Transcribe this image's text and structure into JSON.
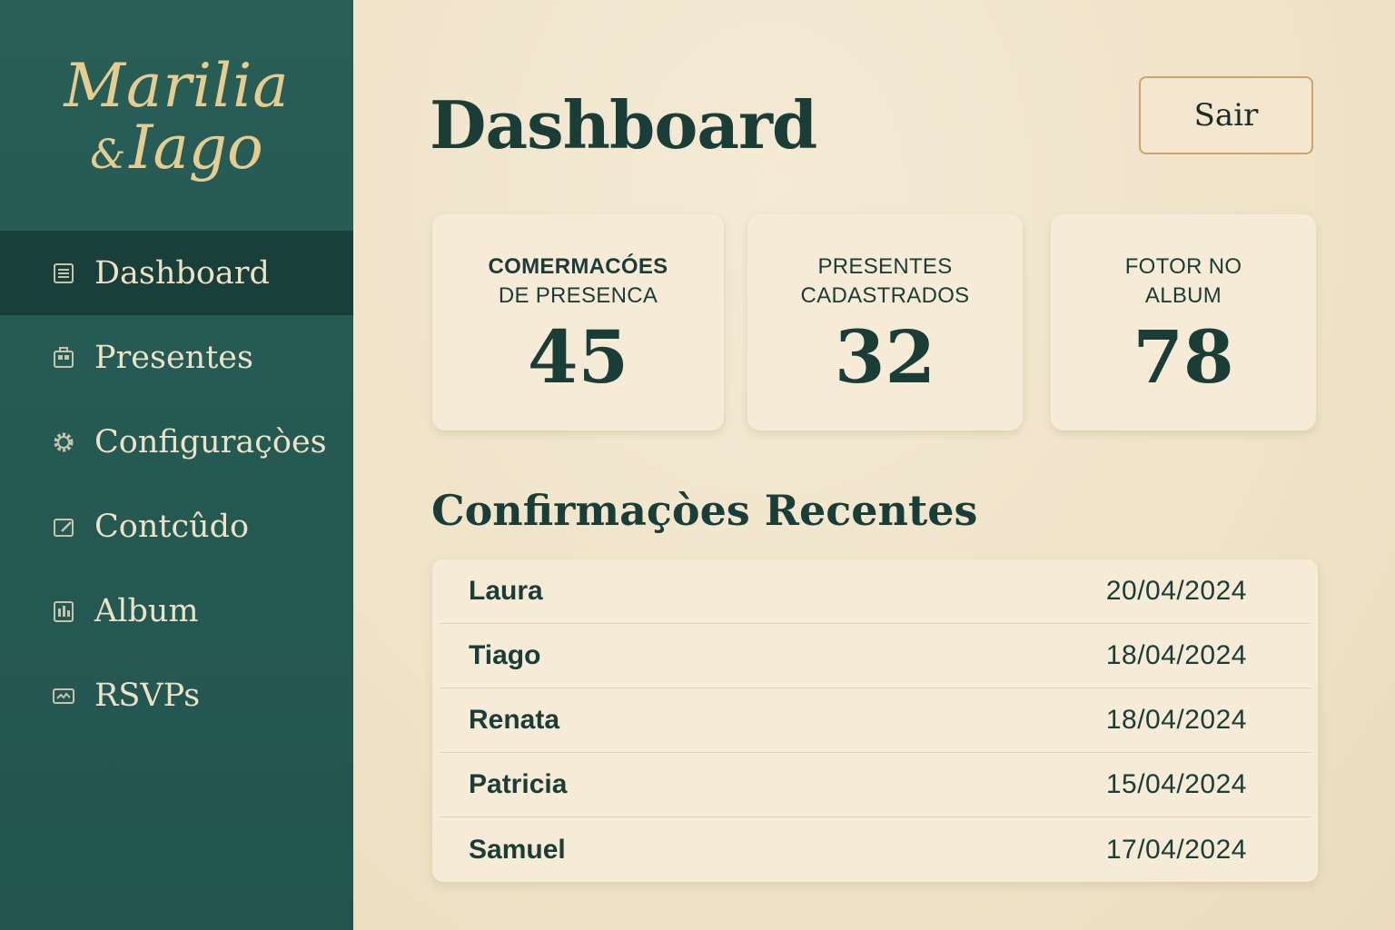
{
  "brand": {
    "line1": "Marilia",
    "amp": "&",
    "line2": "Iago"
  },
  "sidebar": {
    "items": [
      {
        "label": "Dashboard",
        "icon": "dashboard-icon",
        "active": true
      },
      {
        "label": "Presentes",
        "icon": "gift-icon"
      },
      {
        "label": "Configuraçòes",
        "icon": "gear-icon"
      },
      {
        "label": "Contcûdo",
        "icon": "edit-icon"
      },
      {
        "label": "Album",
        "icon": "album-icon"
      },
      {
        "label": "RSVPs",
        "icon": "envelope-icon"
      }
    ]
  },
  "header": {
    "title": "Dashboard",
    "logout_label": "Sair"
  },
  "stats": [
    {
      "label_line1": "COMERMACÓES",
      "label_line2": "DE PRESENCA",
      "value": "45"
    },
    {
      "label_line1": "PRESENTES",
      "label_line2": "CADASTRADOS",
      "value": "32"
    },
    {
      "label_line1": "FOTOR NO",
      "label_line2": "ALBUM",
      "value": "78"
    }
  ],
  "recent": {
    "title": "Confirmaçòes Recentes",
    "rows": [
      {
        "name": "Laura",
        "date": "20/04/2024"
      },
      {
        "name": "Tiago",
        "date": "18/04/2024"
      },
      {
        "name": "Renata",
        "date": "18/04/2024"
      },
      {
        "name": "Patricia",
        "date": "15/04/2024"
      },
      {
        "name": "Samuel",
        "date": "17/04/2024"
      }
    ]
  },
  "colors": {
    "sidebar": "#285e57",
    "sidebar_active": "#193f3b",
    "gold": "#e6cd8f",
    "background": "#efe3c8",
    "text_dark": "#1a3d38"
  }
}
